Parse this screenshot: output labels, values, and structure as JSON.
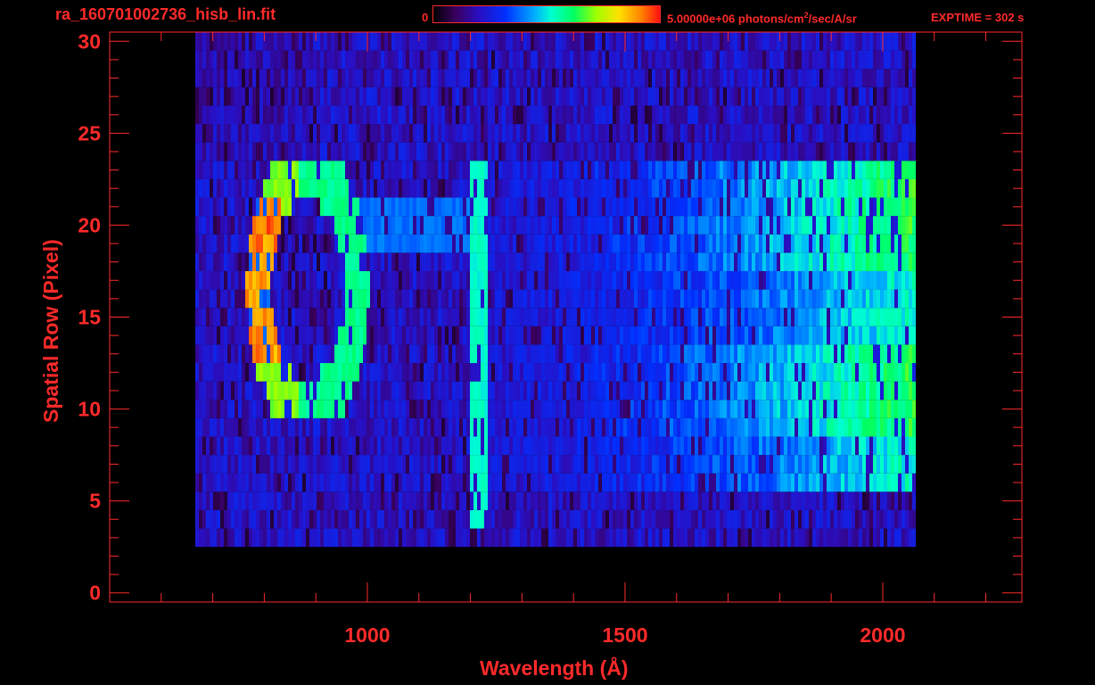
{
  "header": {
    "filename": "ra_160701002736_hisb_lin.fit",
    "colorbar_min": "0",
    "colorbar_max_pre": "5.00000e+06 photons/cm",
    "colorbar_max_sup": "2",
    "colorbar_max_post": "/sec/A/sr",
    "exptime": "EXPTIME = 302 s"
  },
  "colors": {
    "text": "#ff2a2a",
    "axes": "#ff2a2a",
    "background": "#000000"
  },
  "chart_data": {
    "type": "heatmap",
    "xlabel": "Wavelength (Å)",
    "ylabel": "Spatial Row (Pixel)",
    "xlim": [
      500,
      2270
    ],
    "ylim": [
      -0.5,
      30.5
    ],
    "xticks": [
      1000,
      1500,
      2000
    ],
    "yticks": [
      0,
      5,
      10,
      15,
      20,
      25,
      30
    ],
    "colorscale": {
      "min": 0,
      "max": 5000000,
      "unit": "photons/cm^2/sec/A/sr",
      "scale": "linear"
    },
    "features": [
      {
        "name": "bright ring emission",
        "x_range": [
          770,
          990
        ],
        "rows": [
          10,
          23
        ],
        "peak_rows": [
          15,
          20
        ]
      },
      {
        "name": "narrow line",
        "x_center": 1215,
        "rows": [
          4,
          23
        ]
      },
      {
        "name": "continuum",
        "x_range": [
          1700,
          2060
        ],
        "rows": [
          6,
          23
        ],
        "peak_rows": [
          10,
          21
        ]
      }
    ]
  }
}
